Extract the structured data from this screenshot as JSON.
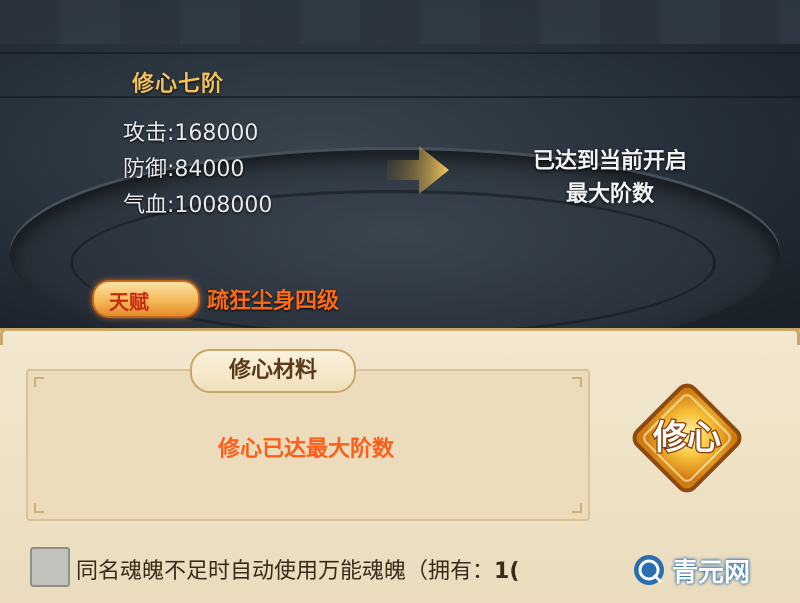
{
  "stage": {
    "title": "修心七阶",
    "stats": [
      {
        "label": "攻击:",
        "value": "168000"
      },
      {
        "label": "防御:",
        "value": "84000"
      },
      {
        "label": "气血:",
        "value": "1008000"
      }
    ]
  },
  "max_notice": {
    "line1": "已达到当前开启",
    "line2": "最大阶数"
  },
  "talent": {
    "badge_label": "天赋",
    "text": "疏狂尘身四级"
  },
  "materials": {
    "tab_title": "修心材料",
    "message": "修心已达最大阶数"
  },
  "cultivate_button": {
    "label": "修心",
    "icon": "cultivate-diamond-icon"
  },
  "auto_use": {
    "checked": false,
    "text": "同名魂魄不足时自动使用万能魂魄（拥有：",
    "count": "1("
  },
  "watermark": {
    "text": "青元网"
  },
  "colors": {
    "title_gold": "#f2c25a",
    "talent_orange": "#ff6a14",
    "message_orange": "#ff5e1a",
    "parchment": "#f2e7cf",
    "panel_border": "#c9a768"
  }
}
